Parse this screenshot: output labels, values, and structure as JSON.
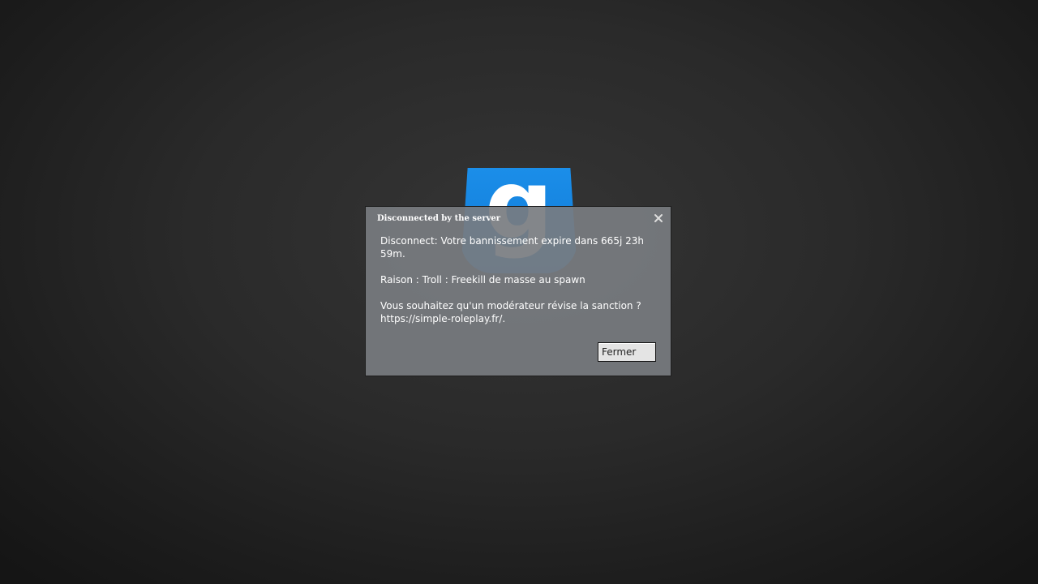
{
  "background": {
    "logo_letter": "g",
    "logo_color": "#1585e0"
  },
  "dialog": {
    "title": "Disconnected by the server",
    "close_icon": "close-icon",
    "message_line_1": "Disconnect: Votre bannissement expire dans 665j 23h 59m.",
    "message_line_2": "Raison : Troll : Freekill de masse au spawn",
    "message_line_3": "Vous souhaitez qu'un modérateur révise la sanction ? https://simple-roleplay.fr/.",
    "button_label": "Fermer"
  }
}
